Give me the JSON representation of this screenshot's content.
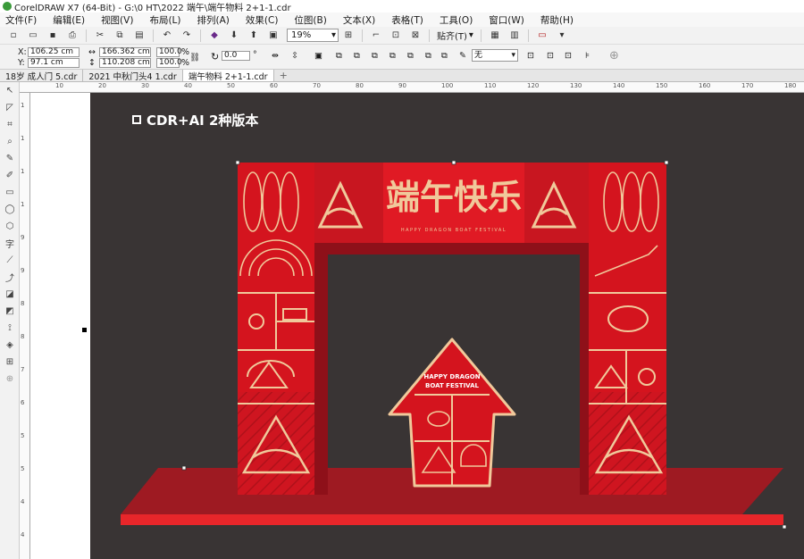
{
  "window": {
    "title": "CorelDRAW X7 (64-Bit) - G:\\0 HT\\2022 端午\\端午物料 2+1-1.cdr"
  },
  "menu": [
    "文件(F)",
    "编辑(E)",
    "视图(V)",
    "布局(L)",
    "排列(A)",
    "效果(C)",
    "位图(B)",
    "文本(X)",
    "表格(T)",
    "工具(O)",
    "窗口(W)",
    "帮助(H)"
  ],
  "toolbar": {
    "zoom": "19%",
    "snap_label": "贴齐(T)"
  },
  "properties": {
    "x_label": "X:",
    "x": "106.25 cm",
    "y_label": "Y:",
    "y": "97.1 cm",
    "w": "166.362 cm",
    "h": "110.208 cm",
    "scale_w": "100.0",
    "scale_h": "100.0",
    "pct": "%",
    "rotate": "0.0",
    "rotate_unit": "°",
    "outline": "无"
  },
  "tabs": [
    "18岁 成人门 5.cdr",
    "2021 中秋门头4 1.cdr",
    "端午物料 2+1-1.cdr"
  ],
  "ruler_h": [
    "10",
    "20",
    "30",
    "40",
    "50",
    "60",
    "70",
    "80",
    "90",
    "100",
    "110",
    "120",
    "130",
    "140",
    "150",
    "160",
    "170",
    "180"
  ],
  "ruler_v": [
    "1",
    "1",
    "1",
    "1",
    "9",
    "9",
    "8",
    "8",
    "7",
    "6",
    "5",
    "5",
    "4",
    "4"
  ],
  "canvas": {
    "heading": "CDR+AI 2种版本",
    "arch_title": "端午快乐",
    "arch_subtitle": "HAPPY DRAGON BOAT FESTIVAL",
    "kiosk_line1": "HAPPY DRAGON",
    "kiosk_line2": "BOAT FESTIVAL"
  },
  "colors": {
    "canvas_bg": "#393434",
    "red": "#d4141e",
    "dark_red": "#a0121c",
    "gold": "#f0c99b",
    "floor": "#9e1a22",
    "floor_edge": "#e8262a"
  }
}
